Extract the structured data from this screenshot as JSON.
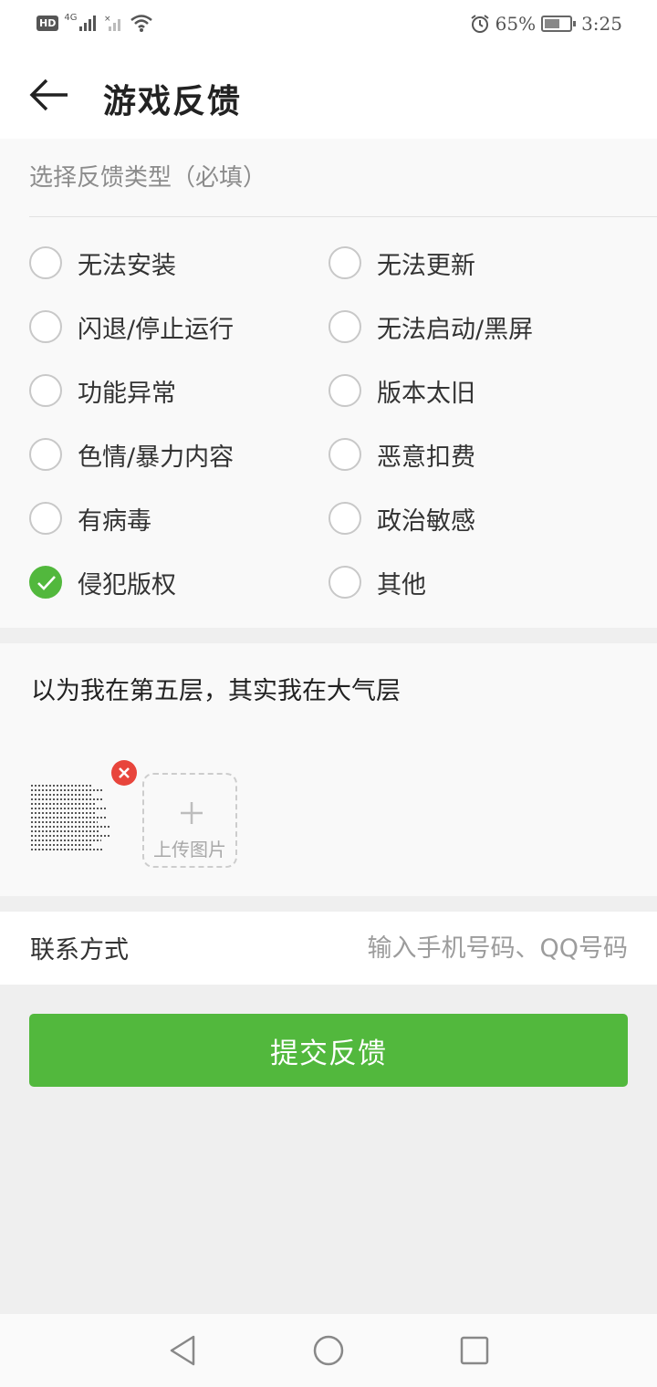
{
  "status_bar": {
    "hd_badge": "HD",
    "network": "4G",
    "battery_percent": "65%",
    "battery_level": 0.65,
    "time": "3:25",
    "icons": [
      "signal-icon",
      "signal-off-icon",
      "wifi-icon",
      "alarm-icon",
      "battery-icon"
    ]
  },
  "header": {
    "title": "游戏反馈"
  },
  "feedback_type": {
    "label": "选择反馈类型（必填）",
    "options": [
      {
        "label": "无法安装",
        "checked": false
      },
      {
        "label": "无法更新",
        "checked": false
      },
      {
        "label": "闪退/停止运行",
        "checked": false
      },
      {
        "label": "无法启动/黑屏",
        "checked": false
      },
      {
        "label": "功能异常",
        "checked": false
      },
      {
        "label": "版本太旧",
        "checked": false
      },
      {
        "label": "色情/暴力内容",
        "checked": false
      },
      {
        "label": "恶意扣费",
        "checked": false
      },
      {
        "label": "有病毒",
        "checked": false
      },
      {
        "label": "政治敏感",
        "checked": false
      },
      {
        "label": "侵犯版权",
        "checked": true
      },
      {
        "label": "其他",
        "checked": false
      }
    ]
  },
  "content": {
    "text": "以为我在第五层，其实我在大气层",
    "upload_label": "上传图片"
  },
  "contact": {
    "label": "联系方式",
    "placeholder": "输入手机号码、QQ号码",
    "value": ""
  },
  "submit": {
    "label": "提交反馈"
  },
  "colors": {
    "accent": "#52b83d",
    "remove": "#e8453c"
  }
}
